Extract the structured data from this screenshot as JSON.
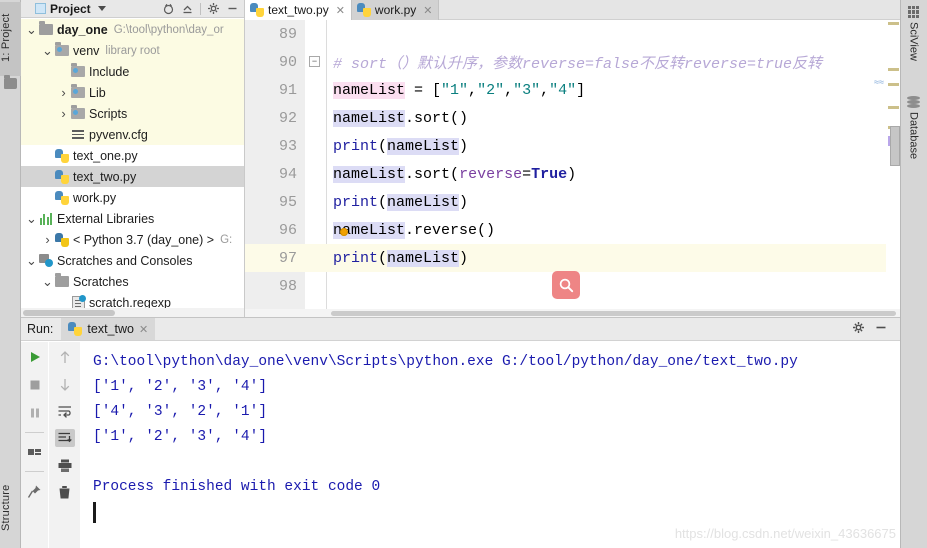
{
  "window": {
    "left_stripe_tabs": [
      {
        "label": "1: Project",
        "icon": "project-icon"
      },
      {
        "label": "Structure",
        "icon": "structure-icon"
      }
    ],
    "right_stripe_tabs": [
      {
        "label": "SciView",
        "icon": "grid-icon"
      },
      {
        "label": "Database",
        "icon": "database-icon"
      }
    ]
  },
  "project_panel": {
    "title": "Project",
    "caret_icon": "chevron-down-icon",
    "square_icon": "project-square-icon",
    "tools": [
      {
        "name": "locate-icon",
        "glyph": "⊙"
      },
      {
        "name": "collapse-all-icon",
        "glyph": "⇥"
      },
      {
        "name": "gear-icon",
        "glyph": "⚙"
      },
      {
        "name": "hide-icon",
        "glyph": "—"
      }
    ],
    "tree": [
      {
        "indent": 0,
        "twist": "down",
        "icon": "folder-icon",
        "label": "day_one",
        "bold": true,
        "sub": "G:\\tool\\python\\day_or",
        "highlight": "yellow"
      },
      {
        "indent": 1,
        "twist": "down",
        "icon": "folder-lib-icon",
        "label": "venv",
        "bold": false,
        "sub": "library root",
        "highlight": "yellow"
      },
      {
        "indent": 2,
        "twist": "none",
        "icon": "folder-lib-icon",
        "label": "Include",
        "bold": false,
        "sub": "",
        "highlight": "yellow"
      },
      {
        "indent": 2,
        "twist": "right",
        "icon": "folder-lib-icon",
        "label": "Lib",
        "bold": false,
        "sub": "",
        "highlight": "yellow"
      },
      {
        "indent": 2,
        "twist": "right",
        "icon": "folder-lib-icon",
        "label": "Scripts",
        "bold": false,
        "sub": "",
        "highlight": "yellow"
      },
      {
        "indent": 2,
        "twist": "none",
        "icon": "config-file-icon",
        "label": "pyvenv.cfg",
        "bold": false,
        "sub": "",
        "highlight": "yellow"
      },
      {
        "indent": 1,
        "twist": "none",
        "icon": "python-file-icon",
        "label": "text_one.py",
        "bold": false,
        "sub": "",
        "highlight": "none"
      },
      {
        "indent": 1,
        "twist": "none",
        "icon": "python-file-icon",
        "label": "text_two.py",
        "bold": false,
        "sub": "",
        "highlight": "selected"
      },
      {
        "indent": 1,
        "twist": "none",
        "icon": "python-file-icon",
        "label": "work.py",
        "bold": false,
        "sub": "",
        "highlight": "none"
      },
      {
        "indent": 0,
        "twist": "down",
        "icon": "external-libraries-icon",
        "label": "External Libraries",
        "bold": false,
        "sub": "",
        "highlight": "none"
      },
      {
        "indent": 1,
        "twist": "right",
        "icon": "python-interpreter-icon",
        "label": "< Python 3.7 (day_one) >",
        "bold": false,
        "sub": "G:",
        "highlight": "none"
      },
      {
        "indent": 0,
        "twist": "down",
        "icon": "scratches-icon",
        "label": "Scratches and Consoles",
        "bold": false,
        "sub": "",
        "highlight": "none"
      },
      {
        "indent": 1,
        "twist": "down",
        "icon": "folder-icon",
        "label": "Scratches",
        "bold": false,
        "sub": "",
        "highlight": "none"
      },
      {
        "indent": 2,
        "twist": "none",
        "icon": "regexp-file-icon",
        "label": "scratch.regexp",
        "bold": false,
        "sub": "",
        "highlight": "none"
      }
    ]
  },
  "editor": {
    "tabs": [
      {
        "label": "text_two.py",
        "icon": "python-file-icon",
        "active": true,
        "close_icon": "close-icon"
      },
      {
        "label": "work.py",
        "icon": "python-file-icon",
        "active": false,
        "close_icon": "close-icon"
      }
    ],
    "find_badge_icon": "search-icon",
    "current_line": 97,
    "lines": [
      {
        "no": "89",
        "segments": []
      },
      {
        "no": "90",
        "fold": "−",
        "segments": [
          {
            "cls": "tok-comment",
            "text": "# sort（）默认升序，参数reverse=false不反转reverse=true反转"
          }
        ]
      },
      {
        "no": "91",
        "segments": [
          {
            "cls": "tok-var-w",
            "text": "nameList"
          },
          {
            "cls": "tok-var",
            "text": " = ["
          },
          {
            "cls": "tok-str",
            "text": "\"1\""
          },
          {
            "cls": "tok-var",
            "text": ","
          },
          {
            "cls": "tok-str",
            "text": "\"2\""
          },
          {
            "cls": "tok-var",
            "text": ","
          },
          {
            "cls": "tok-str",
            "text": "\"3\""
          },
          {
            "cls": "tok-var",
            "text": ","
          },
          {
            "cls": "tok-str",
            "text": "\"4\""
          },
          {
            "cls": "tok-var",
            "text": "]"
          }
        ]
      },
      {
        "no": "92",
        "segments": [
          {
            "cls": "tok-var-r",
            "text": "nameList"
          },
          {
            "cls": "tok-var",
            "text": "."
          },
          {
            "cls": "tok-fn",
            "text": "sort"
          },
          {
            "cls": "tok-var",
            "text": "()"
          }
        ]
      },
      {
        "no": "93",
        "segments": [
          {
            "cls": "tok-print",
            "text": "print"
          },
          {
            "cls": "tok-var",
            "text": "("
          },
          {
            "cls": "tok-var-r",
            "text": "nameList"
          },
          {
            "cls": "tok-var",
            "text": ")"
          }
        ]
      },
      {
        "no": "94",
        "segments": [
          {
            "cls": "tok-var-r",
            "text": "nameList"
          },
          {
            "cls": "tok-var",
            "text": "."
          },
          {
            "cls": "tok-fn",
            "text": "sort"
          },
          {
            "cls": "tok-var",
            "text": "("
          },
          {
            "cls": "tok-kwarg",
            "text": "reverse"
          },
          {
            "cls": "tok-var",
            "text": "="
          },
          {
            "cls": "tok-kw",
            "text": "True"
          },
          {
            "cls": "tok-var",
            "text": ")"
          }
        ]
      },
      {
        "no": "95",
        "segments": [
          {
            "cls": "tok-print",
            "text": "print"
          },
          {
            "cls": "tok-var",
            "text": "("
          },
          {
            "cls": "tok-var-r",
            "text": "nameList"
          },
          {
            "cls": "tok-var",
            "text": ")"
          }
        ]
      },
      {
        "no": "96",
        "segments": [
          {
            "cls": "tok-var-r",
            "text": "nameList"
          },
          {
            "cls": "tok-var",
            "text": "."
          },
          {
            "cls": "tok-fn",
            "text": "reverse"
          },
          {
            "cls": "tok-var",
            "text": "()"
          }
        ]
      },
      {
        "no": "97",
        "current": true,
        "segments": [
          {
            "cls": "tok-print",
            "text": "print"
          },
          {
            "cls": "tok-var",
            "text": "("
          },
          {
            "cls": "tok-var-r",
            "text": "nameList"
          },
          {
            "cls": "tok-var",
            "text": ")"
          }
        ]
      },
      {
        "no": "98",
        "segments": []
      }
    ]
  },
  "run_panel": {
    "label": "Run:",
    "tab": {
      "label": "text_two",
      "icon": "python-file-icon",
      "close_icon": "close-icon"
    },
    "header_tools": [
      {
        "name": "gear-icon",
        "glyph": "⚙"
      },
      {
        "name": "hide-icon",
        "glyph": "—"
      }
    ],
    "tools_left": [
      {
        "name": "rerun-icon",
        "glyph": "▶",
        "enabled": true
      },
      {
        "name": "stop-icon",
        "glyph": "■",
        "enabled": false
      },
      {
        "name": "pause-icon",
        "glyph": "❙❙",
        "enabled": false
      },
      {
        "name": "restore-layout-icon",
        "glyph": "▬",
        "enabled": true
      },
      {
        "name": "pin-tab-icon",
        "glyph": "📌",
        "enabled": true
      }
    ],
    "tools_right": [
      {
        "name": "up-arrow-icon",
        "glyph": "↑",
        "enabled": false
      },
      {
        "name": "down-arrow-icon",
        "glyph": "↓",
        "enabled": false
      },
      {
        "name": "soft-wrap-icon",
        "glyph": "⇥",
        "enabled": true
      },
      {
        "name": "scroll-to-end-icon",
        "glyph": "⇟",
        "enabled": true,
        "active": true
      },
      {
        "name": "print-icon",
        "glyph": "🖨",
        "enabled": true
      },
      {
        "name": "clear-all-icon",
        "glyph": "🗑",
        "enabled": true
      }
    ],
    "console_lines": [
      "G:\\tool\\python\\day_one\\venv\\Scripts\\python.exe G:/tool/python/day_one/text_two.py",
      "['1', '2', '3', '4']",
      "['4', '3', '2', '1']",
      "['1', '2', '3', '4']",
      "",
      "Process finished with exit code 0"
    ],
    "console_text_color": "#1a1aae"
  },
  "watermark": "https://blog.csdn.net/weixin_43636675"
}
